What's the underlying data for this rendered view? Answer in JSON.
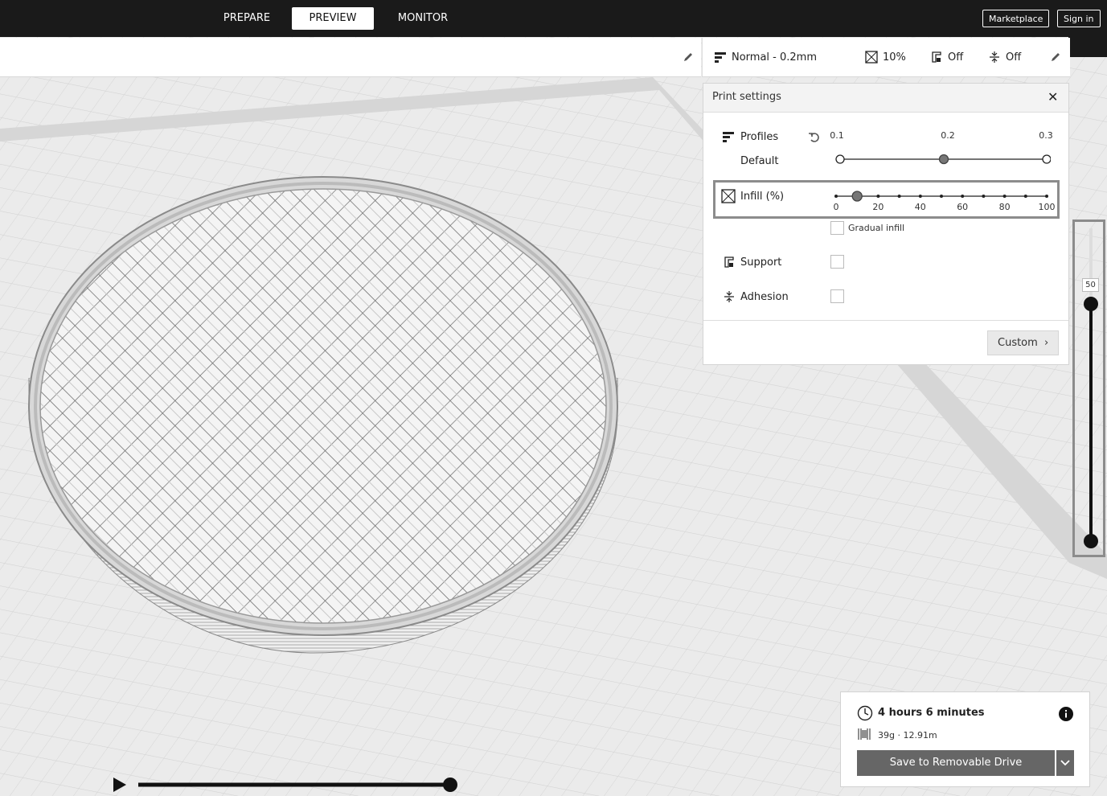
{
  "stages": {
    "prepare": "PREPARE",
    "preview": "PREVIEW",
    "monitor": "MONITOR"
  },
  "header": {
    "marketplace": "Marketplace",
    "sign_in": "Sign in"
  },
  "settings_bar": {
    "profile": "Normal - 0.2mm",
    "infill": "10%",
    "support": "Off",
    "adhesion": "Off"
  },
  "print_settings": {
    "title": "Print settings",
    "profiles_label": "Profiles",
    "default_label": "Default",
    "layer_height_ticks": [
      "0.1",
      "0.2",
      "0.3"
    ],
    "layer_height_selected": "0.2",
    "infill_label": "Infill (%)",
    "infill_ticks": [
      "0",
      "20",
      "40",
      "60",
      "80",
      "100"
    ],
    "infill_value": 10,
    "gradual_infill": "Gradual infill",
    "support_label": "Support",
    "adhesion_label": "Adhesion",
    "custom_button": "Custom"
  },
  "layer_view": {
    "current_layer": "50",
    "max_fraction": 0.32
  },
  "estimate": {
    "time": "4 hours 6 minutes",
    "material": "39g · 12.91m",
    "save_button": "Save to Removable Drive"
  },
  "simulation": {
    "progress": 1.0
  }
}
